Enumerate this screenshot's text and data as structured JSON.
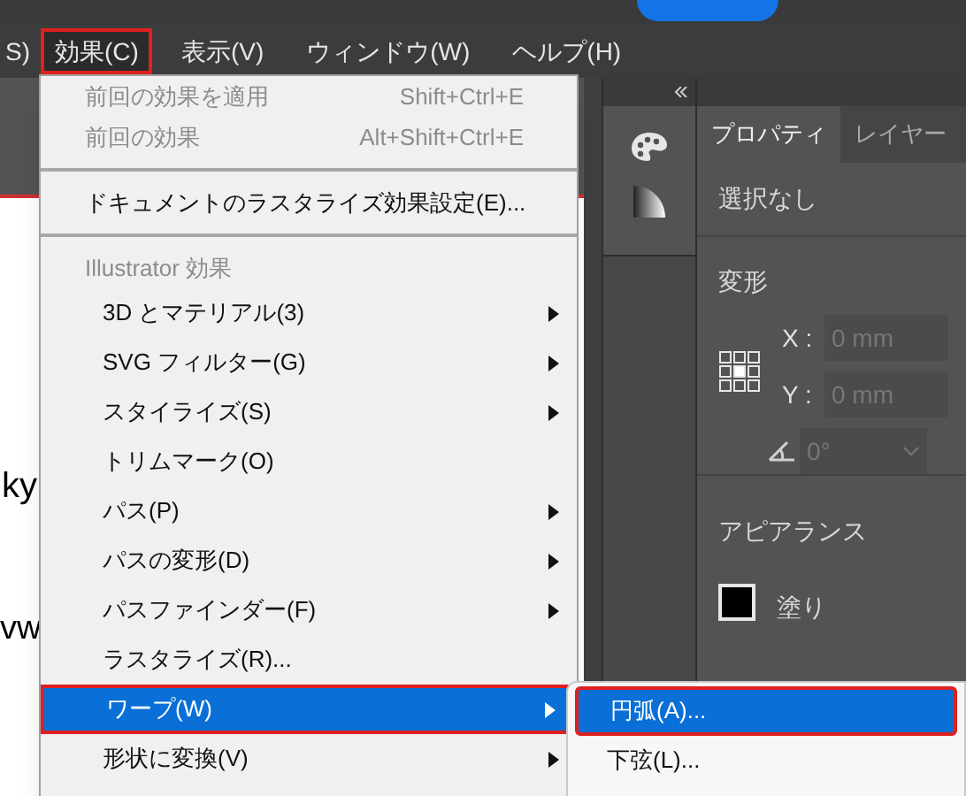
{
  "menubar": [
    {
      "label": "S)",
      "selected": false,
      "outlined": false
    },
    {
      "label": "効果(C)",
      "selected": true,
      "outlined": true
    },
    {
      "label": "表示(V)",
      "selected": false,
      "outlined": false
    },
    {
      "label": "ウィンドウ(W)",
      "selected": false,
      "outlined": false
    },
    {
      "label": "ヘルプ(H)",
      "selected": false,
      "outlined": false
    }
  ],
  "canvas": {
    "texts": [
      "ky",
      "vw"
    ]
  },
  "effect_menu": {
    "items": [
      {
        "kind": "item",
        "label": "前回の効果を適用",
        "shortcut": "Shift+Ctrl+E",
        "disabled": true,
        "submenu": false,
        "selected": false,
        "outlined": false
      },
      {
        "kind": "item",
        "label": "前回の効果",
        "shortcut": "Alt+Shift+Ctrl+E",
        "disabled": true,
        "submenu": false,
        "selected": false,
        "outlined": false
      },
      {
        "kind": "separator"
      },
      {
        "kind": "item",
        "label": "ドキュメントのラスタライズ効果設定(E)...",
        "disabled": false,
        "submenu": false,
        "selected": false,
        "outlined": false
      },
      {
        "kind": "separator"
      },
      {
        "kind": "header",
        "label": "Illustrator 効果"
      },
      {
        "kind": "sub",
        "label": "3D とマテリアル(3)",
        "disabled": false,
        "submenu": true,
        "selected": false,
        "outlined": false
      },
      {
        "kind": "sub",
        "label": "SVG フィルター(G)",
        "disabled": false,
        "submenu": true,
        "selected": false,
        "outlined": false
      },
      {
        "kind": "sub",
        "label": "スタイライズ(S)",
        "disabled": false,
        "submenu": true,
        "selected": false,
        "outlined": false
      },
      {
        "kind": "sub",
        "label": "トリムマーク(O)",
        "disabled": false,
        "submenu": false,
        "selected": false,
        "outlined": false
      },
      {
        "kind": "sub",
        "label": "パス(P)",
        "disabled": false,
        "submenu": true,
        "selected": false,
        "outlined": false
      },
      {
        "kind": "sub",
        "label": "パスの変形(D)",
        "disabled": false,
        "submenu": true,
        "selected": false,
        "outlined": false
      },
      {
        "kind": "sub",
        "label": "パスファインダー(F)",
        "disabled": false,
        "submenu": true,
        "selected": false,
        "outlined": false
      },
      {
        "kind": "sub",
        "label": "ラスタライズ(R)...",
        "disabled": false,
        "submenu": false,
        "selected": false,
        "outlined": false
      },
      {
        "kind": "sub",
        "label": "ワープ(W)",
        "disabled": false,
        "submenu": true,
        "selected": true,
        "outlined": true
      },
      {
        "kind": "sub",
        "label": "形状に変換(V)",
        "disabled": false,
        "submenu": true,
        "selected": false,
        "outlined": false
      }
    ]
  },
  "warp_submenu": {
    "items": [
      {
        "label": "円弧(A)...",
        "selected": true,
        "outlined": true
      },
      {
        "label": "下弦(L)...",
        "selected": false,
        "outlined": false
      }
    ]
  },
  "properties_panel": {
    "tabs": [
      {
        "label": "プロパティ",
        "selected": true
      },
      {
        "label": "レイヤー",
        "selected": false
      }
    ],
    "selection": "選択なし",
    "transform": {
      "title": "変形",
      "x_label": "X :",
      "x_value": "0 mm",
      "y_label": "Y :",
      "y_value": "0 mm",
      "angle_value": "0°"
    },
    "appearance": {
      "title": "アピアランス",
      "fill_label": "塗り"
    }
  }
}
